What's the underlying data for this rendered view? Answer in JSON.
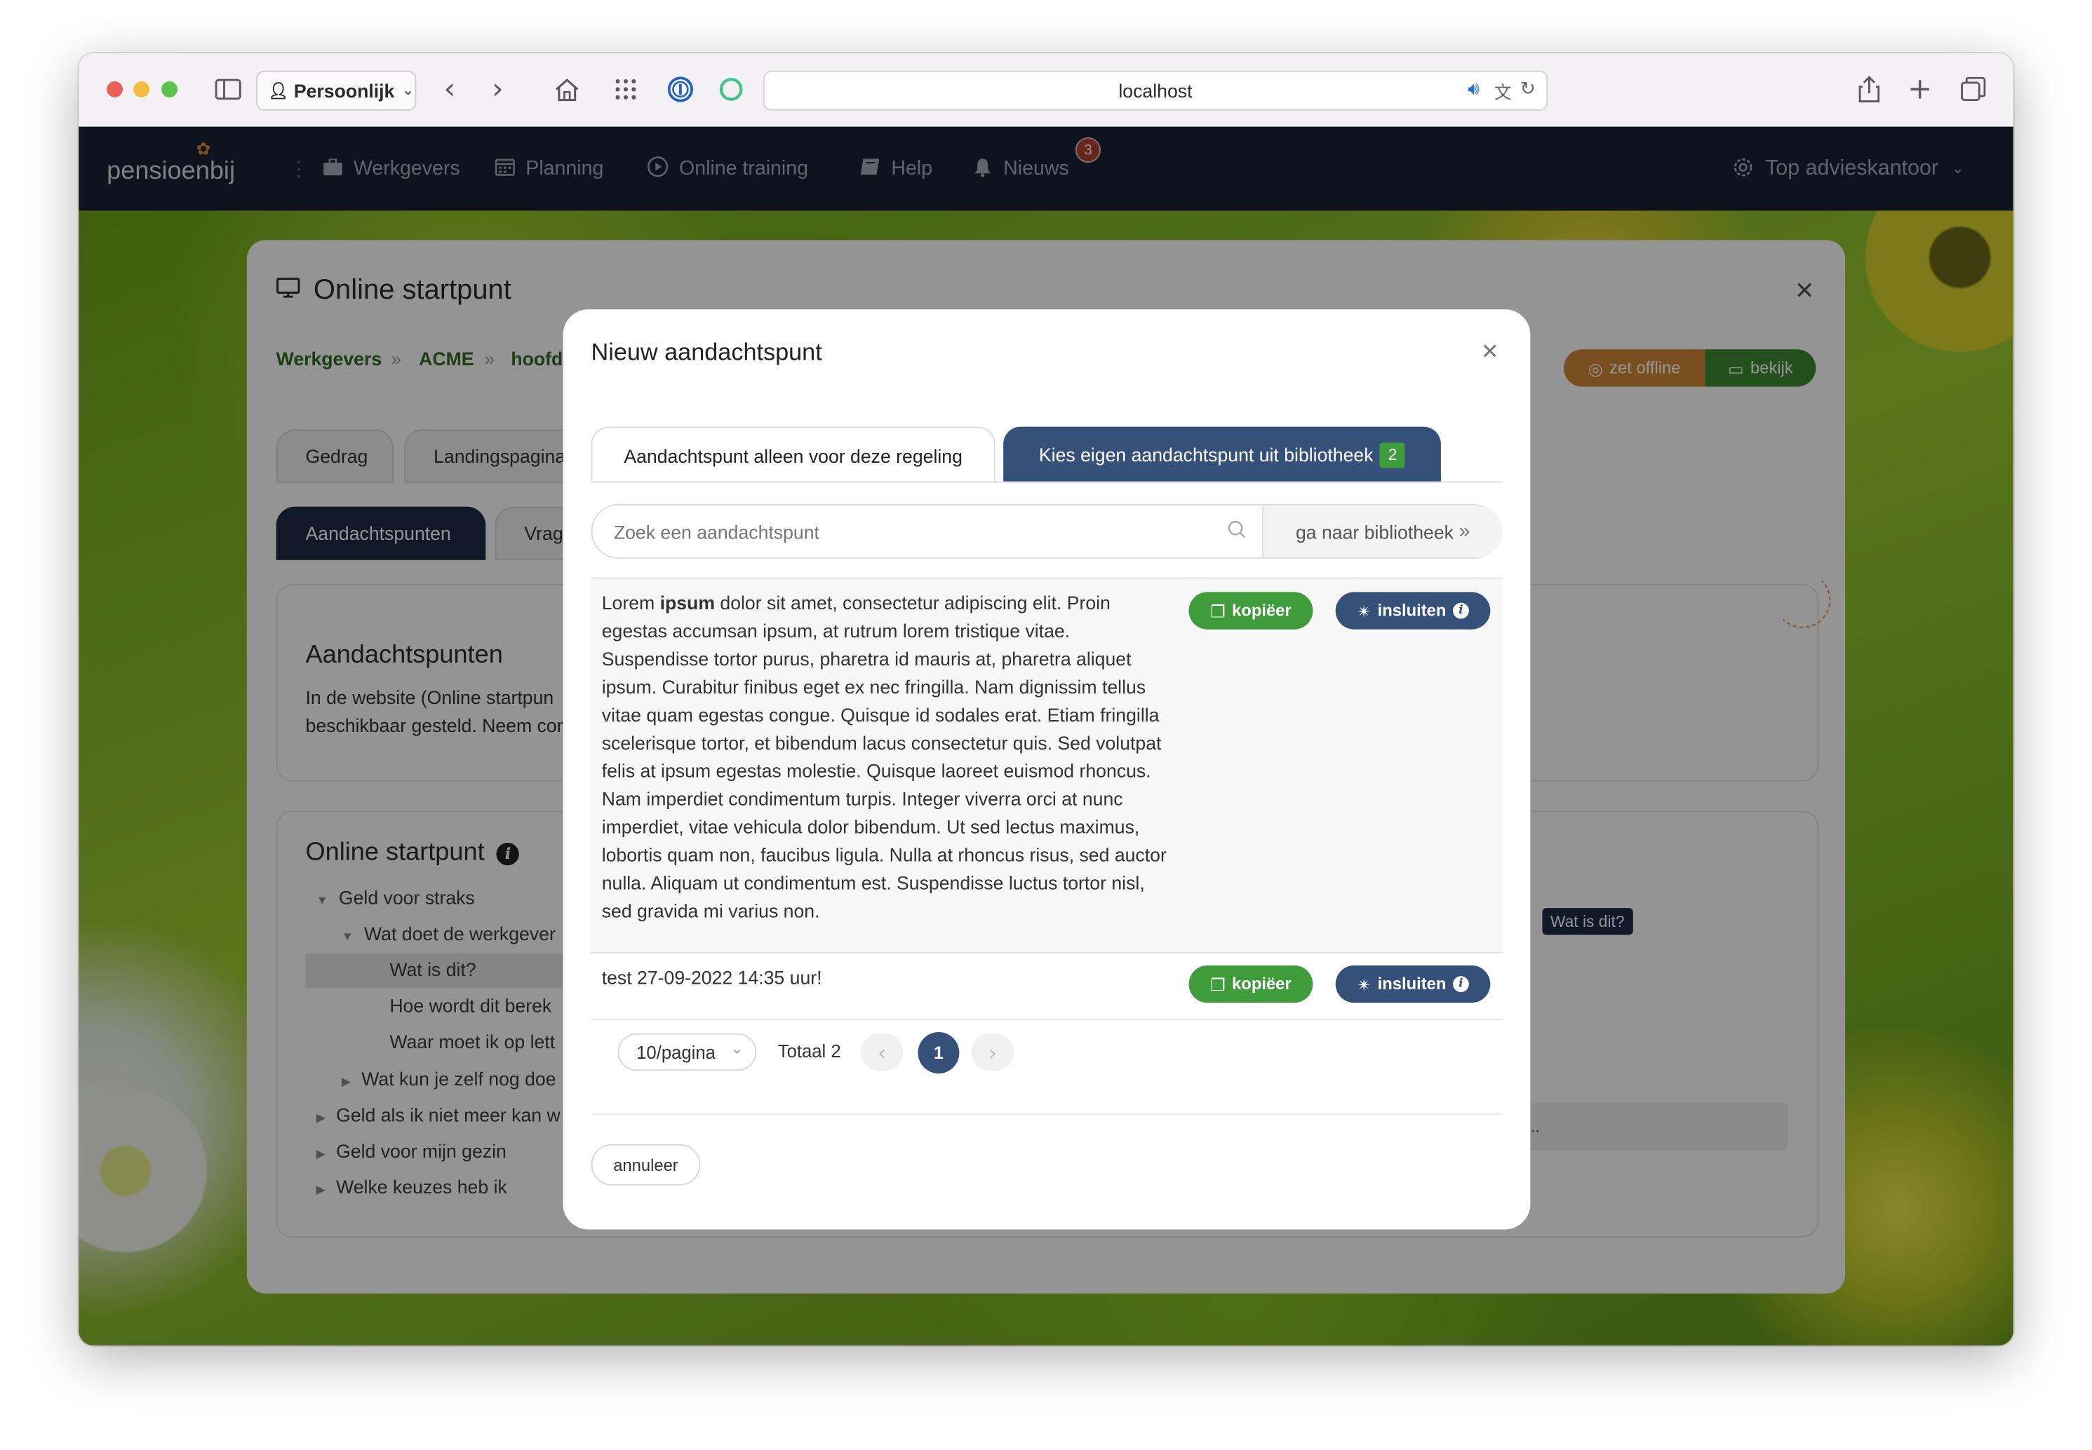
{
  "browser": {
    "profile": "Persoonlijk",
    "url": "localhost"
  },
  "app": {
    "logo": "pensioenbij",
    "nav": [
      {
        "label": "Werkgevers",
        "icon": "briefcase-icon"
      },
      {
        "label": "Planning",
        "icon": "calendar-icon"
      },
      {
        "label": "Online training",
        "icon": "play-circle-icon"
      },
      {
        "label": "Help",
        "icon": "book-icon"
      },
      {
        "label": "Nieuws",
        "icon": "bell-icon",
        "badge": "3"
      }
    ],
    "account": "Top advieskantoor"
  },
  "page": {
    "title": "Online startpunt",
    "breadcrumb": [
      "Werkgevers",
      "ACME",
      "hoofd"
    ],
    "actions": {
      "offline": "zet offline",
      "view": "bekijk"
    },
    "tabs_row1": [
      "Gedrag",
      "Landingspagina"
    ],
    "tabs_row2": [
      "Aandachtspunten",
      "Vrag"
    ],
    "section1_title": "Aandachtspunten",
    "section1_text": [
      "In de website (Online startpun",
      "beschikbaar gesteld. Neem con"
    ],
    "section2_title": "Online startpunt",
    "tree": [
      "Geld voor straks",
      "Wat doet de werkgever",
      "Wat is dit?",
      "Hoe wordt dit berek",
      "Waar moet ik op lett",
      "Wat kun je zelf nog doe",
      "Geld als ik niet meer kan w",
      "Geld voor mijn gezin",
      "Welke keuzes heb ik"
    ],
    "tooltip": "Wat is dit?",
    "right_snippet": "..."
  },
  "modal": {
    "title": "Nieuw aandachtspunt",
    "tab1": "Aandachtspunt alleen voor deze regeling",
    "tab2": "Kies eigen aandachtspunt uit bibliotheek",
    "tab2_badge": "2",
    "search_placeholder": "Zoek een aandachtspunt",
    "library_link": "ga naar bibliotheek",
    "items": [
      {
        "pre": "Lorem ",
        "bold": "ipsum",
        "post": " dolor sit amet, consectetur adipiscing elit. Proin egestas accumsan ipsum, at rutrum lorem tristique vitae. Suspendisse tortor purus, pharetra id mauris at, pharetra aliquet ipsum. Curabitur finibus eget ex nec fringilla. Nam dignissim tellus vitae quam egestas congue. Quisque id sodales erat. Etiam fringilla scelerisque tortor, et bibendum lacus consectetur quis. Sed volutpat felis at ipsum egestas molestie. Quisque laoreet euismod rhoncus. Nam imperdiet condimentum turpis. Integer viverra orci at nunc imperdiet, vitae vehicula dolor bibendum. Ut sed lectus maximus, lobortis quam non, faucibus ligula. Nulla at rhoncus risus, sed auctor nulla. Aliquam ut condimentum est. Suspendisse luctus tortor nisl, sed gravida mi varius non.",
        "copy": "kopiëer",
        "embed": "insluiten"
      },
      {
        "text": "test 27-09-2022 14:35 uur!",
        "copy": "kopiëer",
        "embed": "insluiten"
      }
    ],
    "pagination": {
      "per_page": "10/pagina",
      "total": "Totaal 2",
      "current": "1"
    },
    "cancel": "annuleer"
  }
}
